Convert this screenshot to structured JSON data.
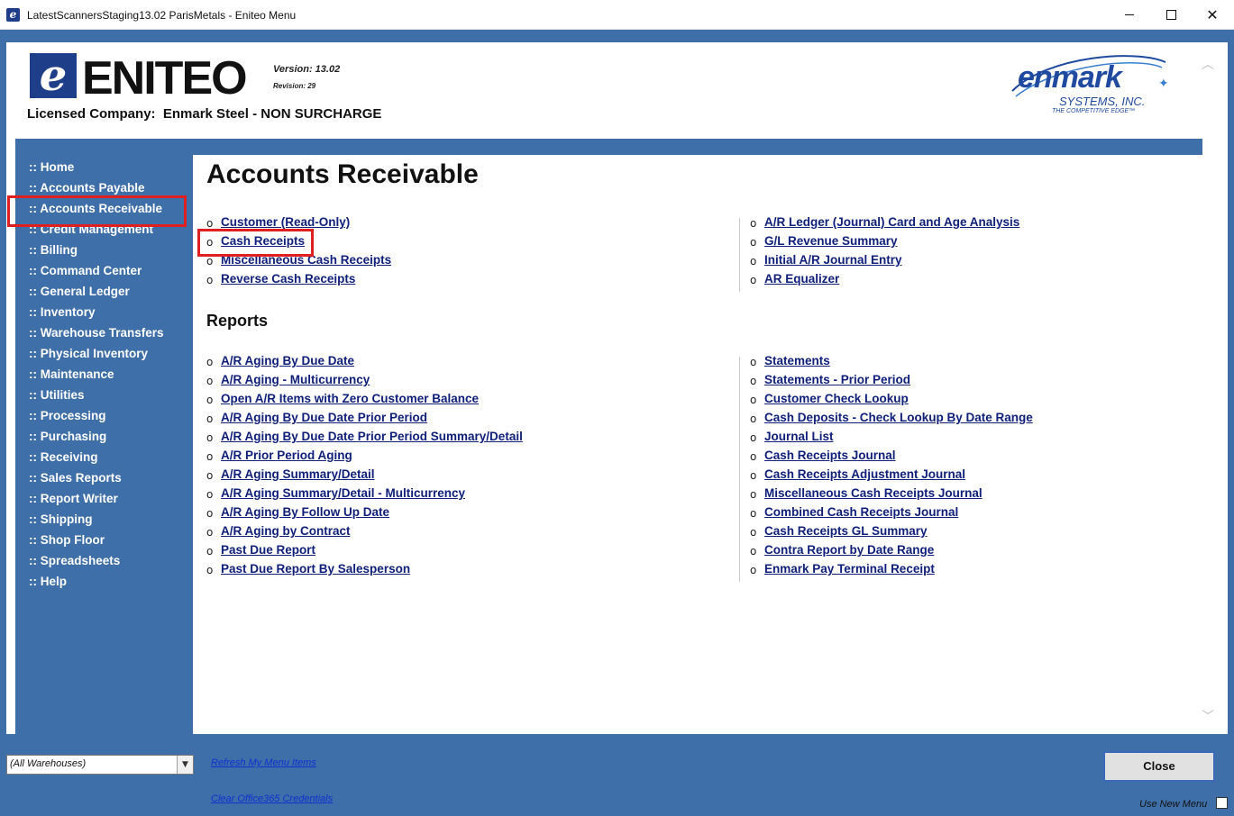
{
  "window": {
    "title": "LatestScannersStaging13.02 ParisMetals - Eniteo Menu",
    "icon_glyph": "e",
    "close_glyph": "✕"
  },
  "header": {
    "logo_letter": "e",
    "logo_text": "ENITEO",
    "version": "Version: 13.02",
    "revision": "Revision: 29",
    "licensed_company": "Licensed Company:  Enmark Steel - NON SURCHARGE",
    "brand_name": "enmark",
    "brand_sub": "SYSTEMS, INC.",
    "brand_tagline": "THE COMPETITIVE EDGE™"
  },
  "nav": {
    "items": [
      ":: Home",
      ":: Accounts Payable",
      ":: Accounts Receivable",
      ":: Credit Management",
      ":: Billing",
      ":: Command Center",
      ":: General Ledger",
      ":: Inventory",
      ":: Warehouse Transfers",
      ":: Physical Inventory",
      ":: Maintenance",
      ":: Utilities",
      ":: Processing",
      ":: Purchasing",
      ":: Receiving",
      ":: Sales Reports",
      ":: Report Writer",
      ":: Shipping",
      ":: Shop Floor",
      ":: Spreadsheets",
      ":: Help"
    ],
    "selected": ":: Accounts Receivable"
  },
  "main": {
    "title": "Accounts Receivable",
    "bullet": "o",
    "functions_left": [
      "Customer (Read-Only)",
      "Cash Receipts",
      "Miscellaneous Cash Receipts",
      "Reverse Cash Receipts"
    ],
    "functions_right": [
      "A/R Ledger (Journal) Card and Age Analysis",
      "G/L Revenue Summary",
      "Initial A/R Journal Entry",
      "AR Equalizer"
    ],
    "reports_heading": "Reports",
    "reports_left": [
      "A/R Aging By Due Date",
      "A/R Aging - Multicurrency",
      "Open A/R Items with Zero Customer Balance",
      "A/R Aging By Due Date Prior Period",
      "A/R Aging By Due Date Prior Period Summary/Detail",
      "A/R Prior Period Aging",
      "A/R Aging Summary/Detail",
      "A/R Aging Summary/Detail - Multicurrency",
      "A/R Aging By Follow Up Date",
      "A/R Aging by Contract",
      "Past Due Report",
      "Past Due Report By Salesperson"
    ],
    "reports_right": [
      "Statements",
      "Statements - Prior Period",
      "Customer Check Lookup",
      "Cash Deposits - Check Lookup By Date Range",
      "Journal List",
      "Cash Receipts Journal",
      "Cash Receipts Adjustment Journal",
      "Miscellaneous Cash Receipts Journal",
      "Combined Cash Receipts Journal",
      "Cash Receipts GL Summary",
      "Contra Report by Date Range",
      "Enmark Pay Terminal Receipt"
    ],
    "highlighted_link": "Cash Receipts"
  },
  "footer": {
    "warehouse_value": "(All Warehouses)",
    "refresh_link": "Refresh My Menu Items",
    "clear_link": "Clear Office365 Credentials",
    "close_label": "Close",
    "use_new_menu_label": "Use New Menu",
    "use_new_menu_checked": false
  },
  "colors": {
    "frame_blue": "#3f6fa8",
    "link_navy": "#10207a",
    "highlight_red": "#e02020"
  }
}
